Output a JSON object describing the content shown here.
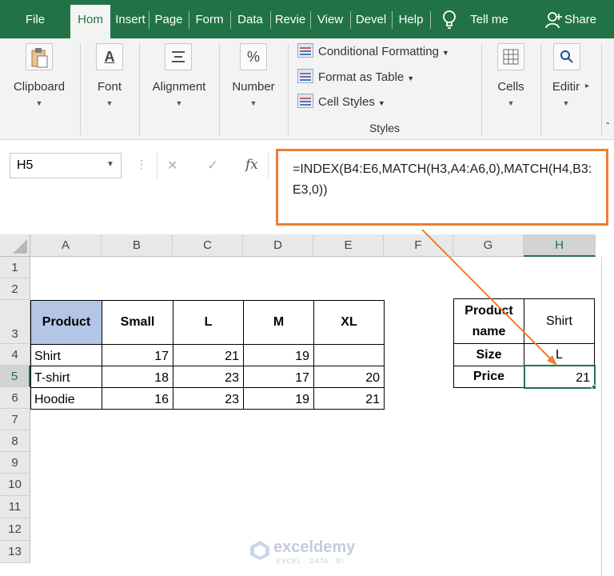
{
  "tabs": [
    {
      "label": "File",
      "active": false
    },
    {
      "label": "Hom",
      "active": true
    },
    {
      "label": "Insert",
      "active": false
    },
    {
      "label": "Page",
      "active": false
    },
    {
      "label": "Form",
      "active": false
    },
    {
      "label": "Data",
      "active": false
    },
    {
      "label": "Revie",
      "active": false
    },
    {
      "label": "View",
      "active": false
    },
    {
      "label": "Devel",
      "active": false
    },
    {
      "label": "Help",
      "active": false
    }
  ],
  "tell_me": "Tell me",
  "share": "Share",
  "ribbon": {
    "clipboard": "Clipboard",
    "font": "Font",
    "alignment": "Alignment",
    "number": "Number",
    "number_icon": "%",
    "font_icon": "A",
    "conditional_formatting": "Conditional Formatting",
    "format_as_table": "Format as Table",
    "cell_styles": "Cell Styles",
    "styles": "Styles",
    "cells": "Cells",
    "editing": "Editir"
  },
  "formula_bar": {
    "name_box": "H5",
    "cancel_icon": "✕",
    "enter_icon": "✓",
    "fx_icon": "fx",
    "formula": "=INDEX(B4:E6,MATCH(H3,A4:A6,0),MATCH(H4,B3:E3,0))"
  },
  "columns": [
    "A",
    "B",
    "C",
    "D",
    "E",
    "F",
    "G",
    "H"
  ],
  "rows": [
    "1",
    "2",
    "3",
    "4",
    "5",
    "6",
    "7",
    "8",
    "9",
    "10",
    "11",
    "12",
    "13"
  ],
  "table": {
    "headers": [
      "Product",
      "Small",
      "L",
      "M",
      "XL"
    ],
    "rows": [
      [
        "Shirt",
        "17",
        "21",
        "19",
        ""
      ],
      [
        "T-shirt",
        "18",
        "23",
        "17",
        "20"
      ],
      [
        "Hoodie",
        "16",
        "23",
        "19",
        "21"
      ]
    ]
  },
  "lookup": {
    "product_name_label": "Product name",
    "product_name_value": "Shirt",
    "size_label": "Size",
    "size_value": "L",
    "price_label": "Price",
    "price_value": "21"
  },
  "watermark": {
    "brand": "exceldemy",
    "tagline": "EXCEL · DATA · BI"
  },
  "colors": {
    "excel_green": "#217346",
    "highlight_orange": "#ef7d31",
    "header_fill": "#b4c6e7"
  }
}
